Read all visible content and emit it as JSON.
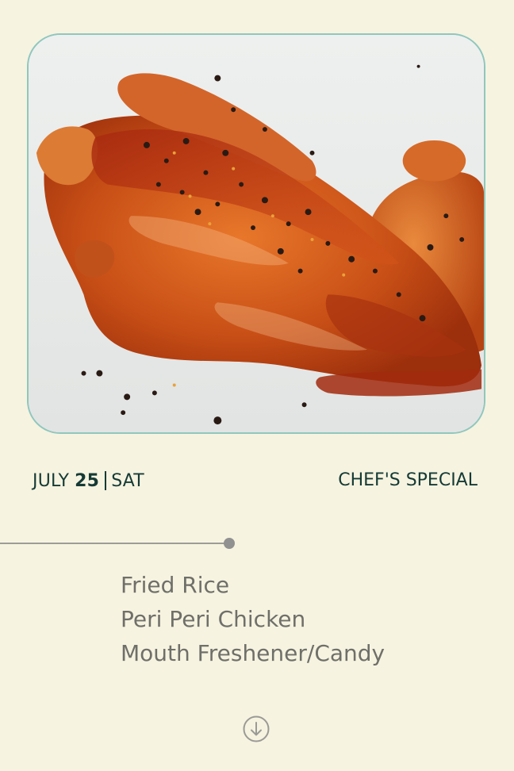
{
  "photo": {
    "icon": "peri-peri-chicken-photo"
  },
  "date": {
    "month": "JULY",
    "day": "25",
    "weekday": "SAT"
  },
  "special_label": "CHEF'S SPECIAL",
  "menu": {
    "items": [
      {
        "label": "Fried Rice"
      },
      {
        "label": "Peri Peri Chicken"
      },
      {
        "label": "Mouth Freshener/Candy"
      }
    ]
  },
  "scroll": {
    "icon": "arrow-down-circle-icon"
  },
  "colors": {
    "background": "#f6f3e0",
    "accent_dark": "#153a35",
    "menu_text": "#6f6f6a",
    "card_border": "#8fc7bd"
  }
}
